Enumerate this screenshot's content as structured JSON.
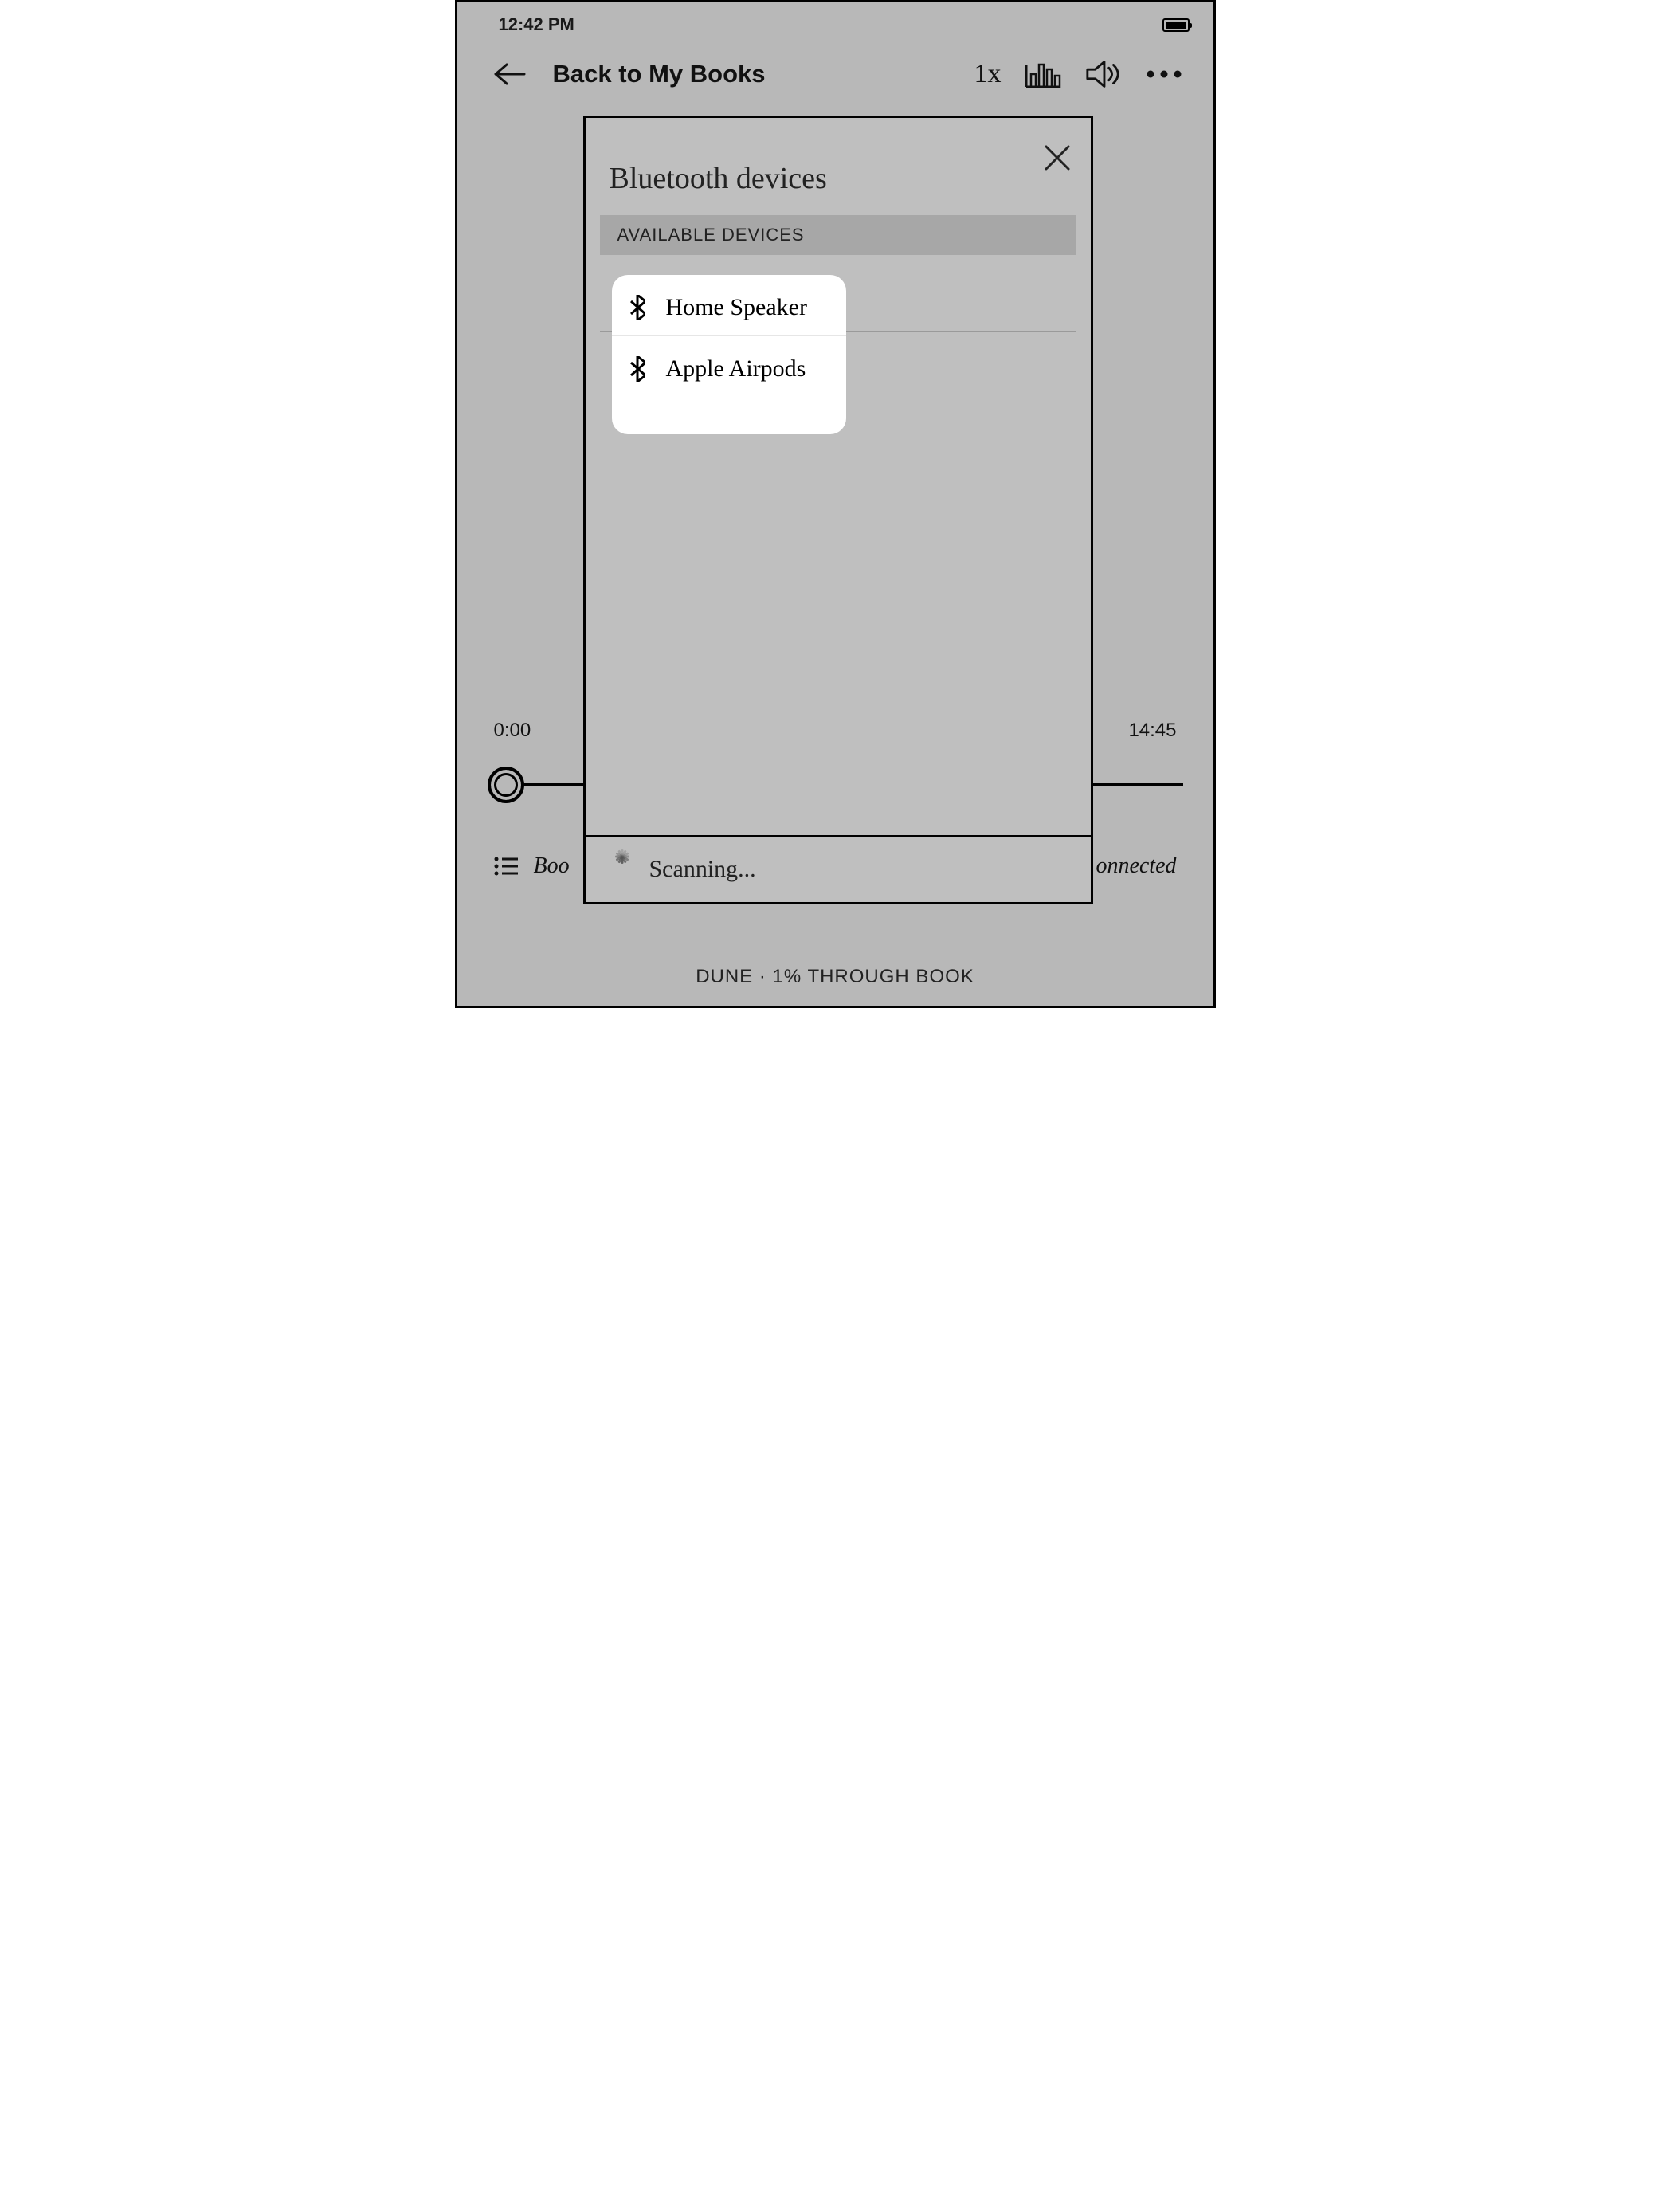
{
  "status": {
    "time": "12:42 PM"
  },
  "toolbar": {
    "back_label": "Back to My Books",
    "speed": "1x"
  },
  "playback": {
    "elapsed": "0:00",
    "remaining": "14:45"
  },
  "bottom": {
    "left_hint": "Boo",
    "right_hint": "onnected",
    "progress": "DUNE · 1% THROUGH BOOK"
  },
  "modal": {
    "title": "Bluetooth devices",
    "section": "AVAILABLE DEVICES",
    "devices": [
      {
        "name": "Home Speaker"
      },
      {
        "name": "Apple Airpods"
      }
    ],
    "footer": "Scanning..."
  }
}
